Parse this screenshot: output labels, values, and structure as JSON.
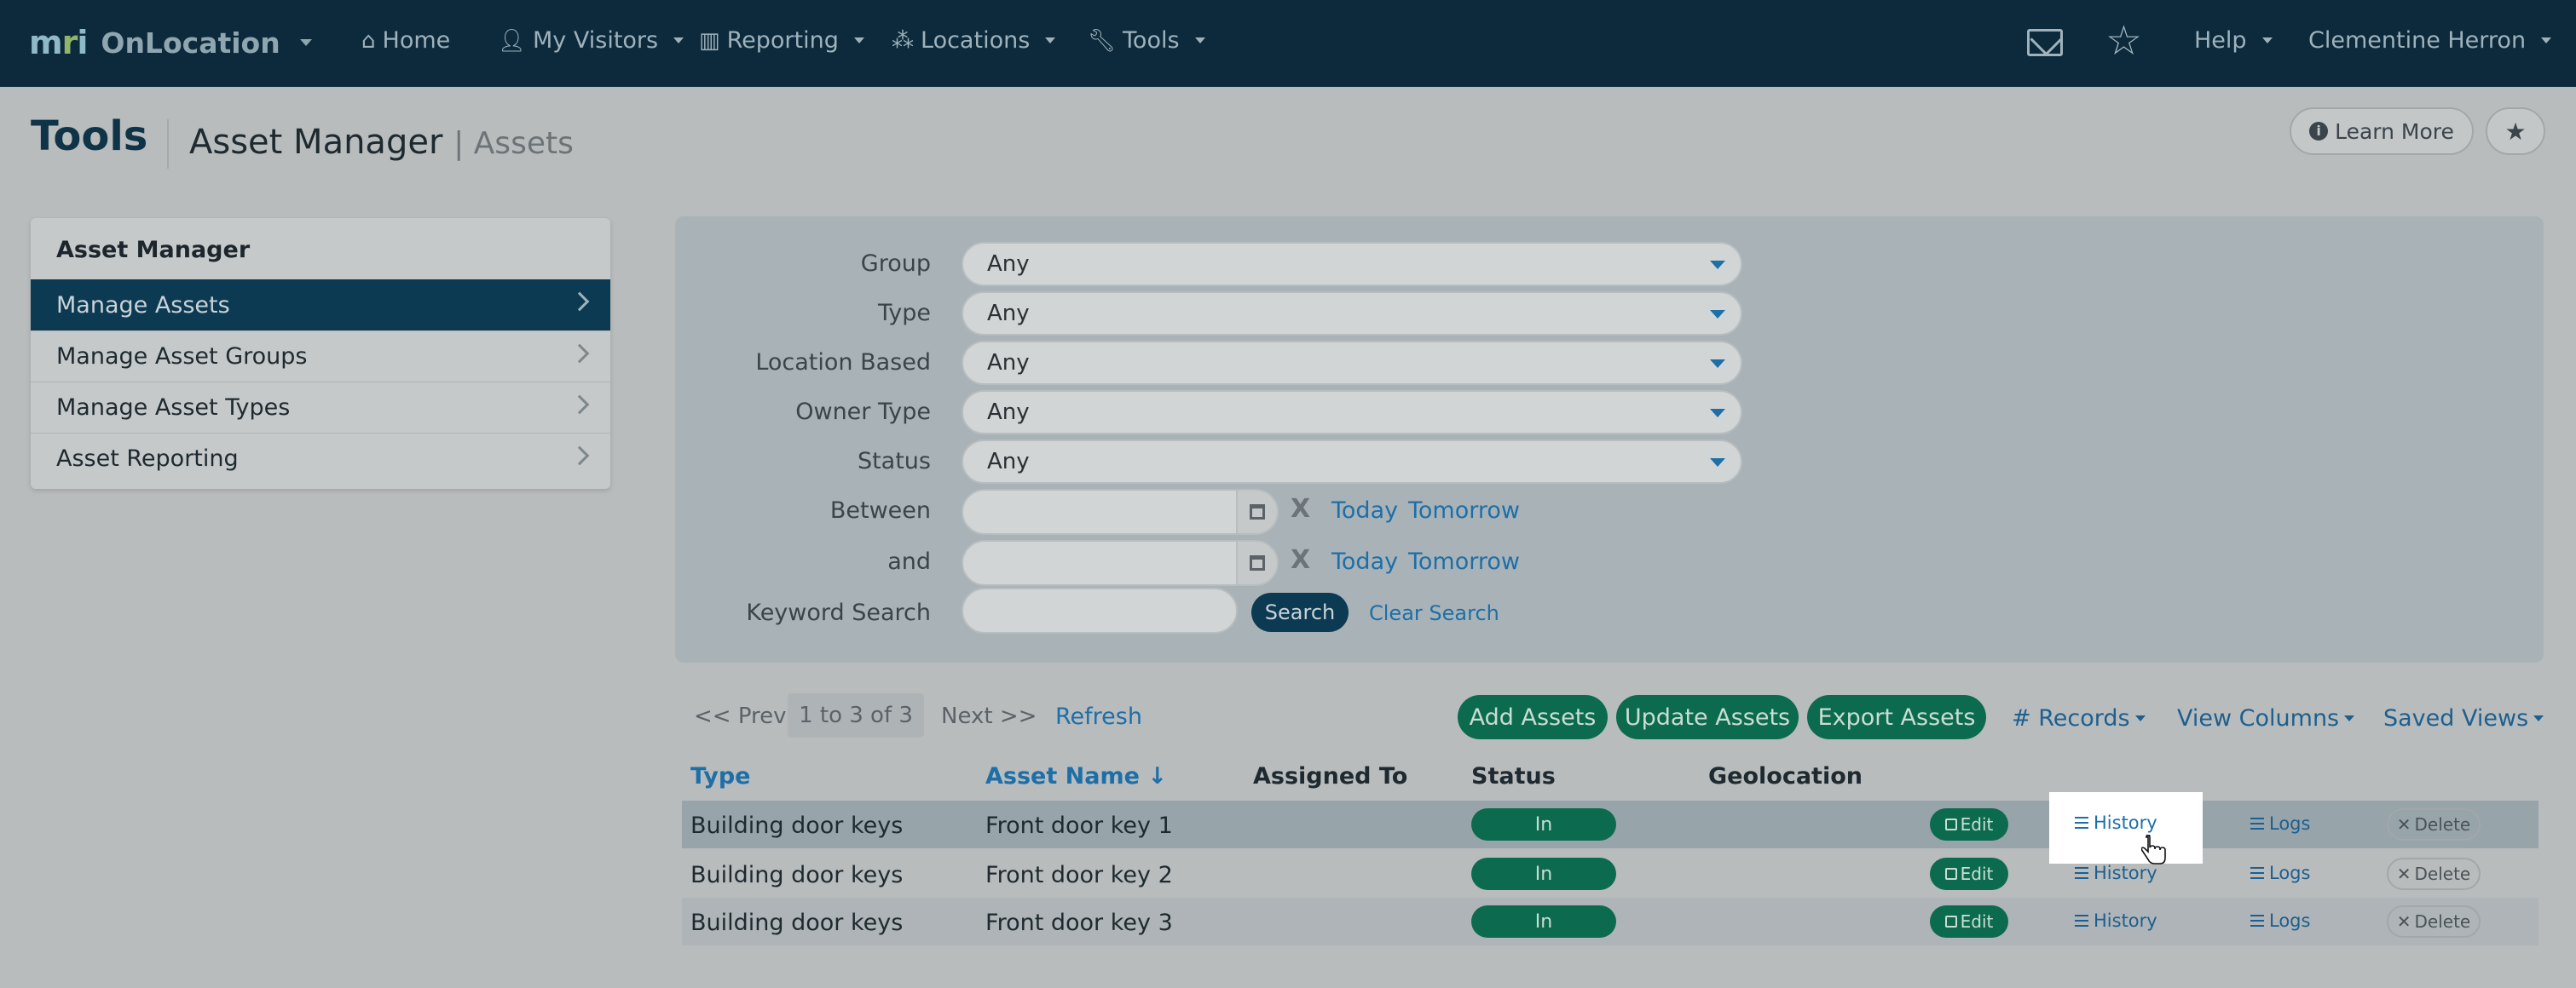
{
  "navbar": {
    "brand_logo": "mri",
    "brand_name": "OnLocation",
    "items": [
      {
        "label": "Home",
        "icon": "home-icon"
      },
      {
        "label": "My Visitors",
        "icon": "user-icon"
      },
      {
        "label": "Reporting",
        "icon": "bar-chart-icon"
      },
      {
        "label": "Locations",
        "icon": "network-icon"
      },
      {
        "label": "Tools",
        "icon": "wrench-icon"
      }
    ],
    "help_label": "Help",
    "user_name": "Clementine Herron"
  },
  "header": {
    "title": "Tools",
    "section": "Asset Manager",
    "subsection": "| Assets",
    "learn_more": "Learn More"
  },
  "sidebar": {
    "title": "Asset Manager",
    "items": [
      {
        "label": "Manage Assets",
        "active": true
      },
      {
        "label": "Manage Asset Groups",
        "active": false
      },
      {
        "label": "Manage Asset Types",
        "active": false
      },
      {
        "label": "Asset Reporting",
        "active": false
      }
    ]
  },
  "filters": {
    "group": {
      "label": "Group",
      "value": "Any"
    },
    "type": {
      "label": "Type",
      "value": "Any"
    },
    "location_based": {
      "label": "Location Based",
      "value": "Any"
    },
    "owner_type": {
      "label": "Owner Type",
      "value": "Any"
    },
    "status": {
      "label": "Status",
      "value": "Any"
    },
    "between": {
      "label": "Between",
      "value": ""
    },
    "and": {
      "label": "and",
      "value": ""
    },
    "today": "Today",
    "tomorrow": "Tomorrow",
    "clear_x": "X",
    "keyword": {
      "label": "Keyword Search",
      "value": ""
    },
    "search_button": "Search",
    "clear_search": "Clear Search"
  },
  "toolbar": {
    "prev": "<< Prev",
    "range": "1 to 3 of 3",
    "next": "Next >>",
    "refresh": "Refresh",
    "add_assets": "Add Assets",
    "update_assets": "Update Assets",
    "export_assets": "Export Assets",
    "records": "# Records",
    "view_columns": "View Columns",
    "saved_views": "Saved Views"
  },
  "table": {
    "headers": {
      "type": "Type",
      "asset_name": "Asset Name ↓",
      "assigned_to": "Assigned To",
      "status": "Status",
      "geolocation": "Geolocation"
    },
    "rows": [
      {
        "type": "Building door keys",
        "asset_name": "Front door key 1",
        "assigned_to": "",
        "status": "In",
        "geolocation": ""
      },
      {
        "type": "Building door keys",
        "asset_name": "Front door key 2",
        "assigned_to": "",
        "status": "In",
        "geolocation": ""
      },
      {
        "type": "Building door keys",
        "asset_name": "Front door key 3",
        "assigned_to": "",
        "status": "In",
        "geolocation": ""
      }
    ],
    "actions": {
      "edit": "Edit",
      "history": "History",
      "logs": "Logs",
      "delete": "Delete"
    }
  },
  "colors": {
    "navbar": "#0c2a3c",
    "primary": "#0c3a52",
    "success": "#0c6b4e",
    "link": "#1d6fa8"
  }
}
